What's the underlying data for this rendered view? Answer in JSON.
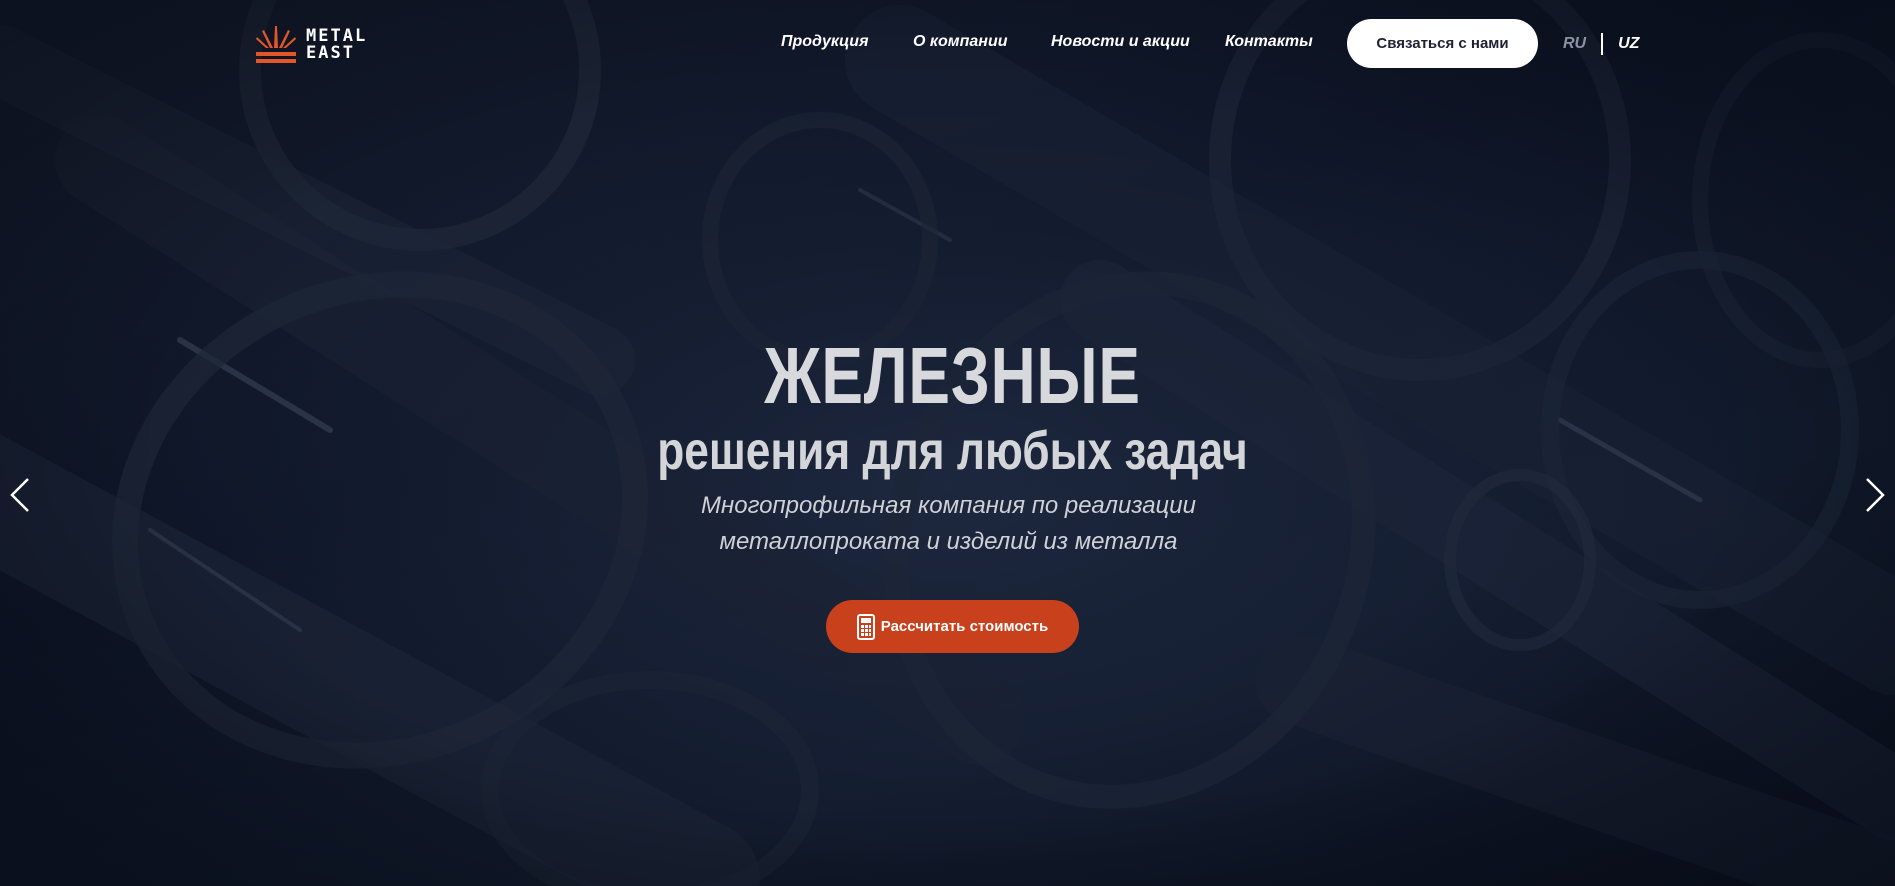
{
  "header": {
    "logo": {
      "line1": "METAL",
      "line2": "EAST",
      "icon": "sunburst-logo-icon"
    },
    "nav": [
      {
        "label": "Продукция"
      },
      {
        "label": "О компании"
      },
      {
        "label": "Новости и акции"
      },
      {
        "label": "Контакты"
      }
    ],
    "contact_button": "Связаться с нами",
    "languages": {
      "active": "UZ",
      "items": [
        "RU",
        "UZ"
      ]
    }
  },
  "hero": {
    "title": "ЖЕЛЕЗНЫЕ",
    "subtitle": "решения для любых задач",
    "description_line1": "Многопрофильная компания по реализации",
    "description_line2": "металлопроката и изделий из металла",
    "cta_label": "Рассчитать стоимость",
    "cta_icon": "calculator-icon",
    "prev_icon": "chevron-left-icon",
    "next_icon": "chevron-right-icon"
  },
  "colors": {
    "background": "#0d1424",
    "accent": "#c8411c",
    "logo_accent": "#e2562a",
    "text": "#ffffff"
  }
}
